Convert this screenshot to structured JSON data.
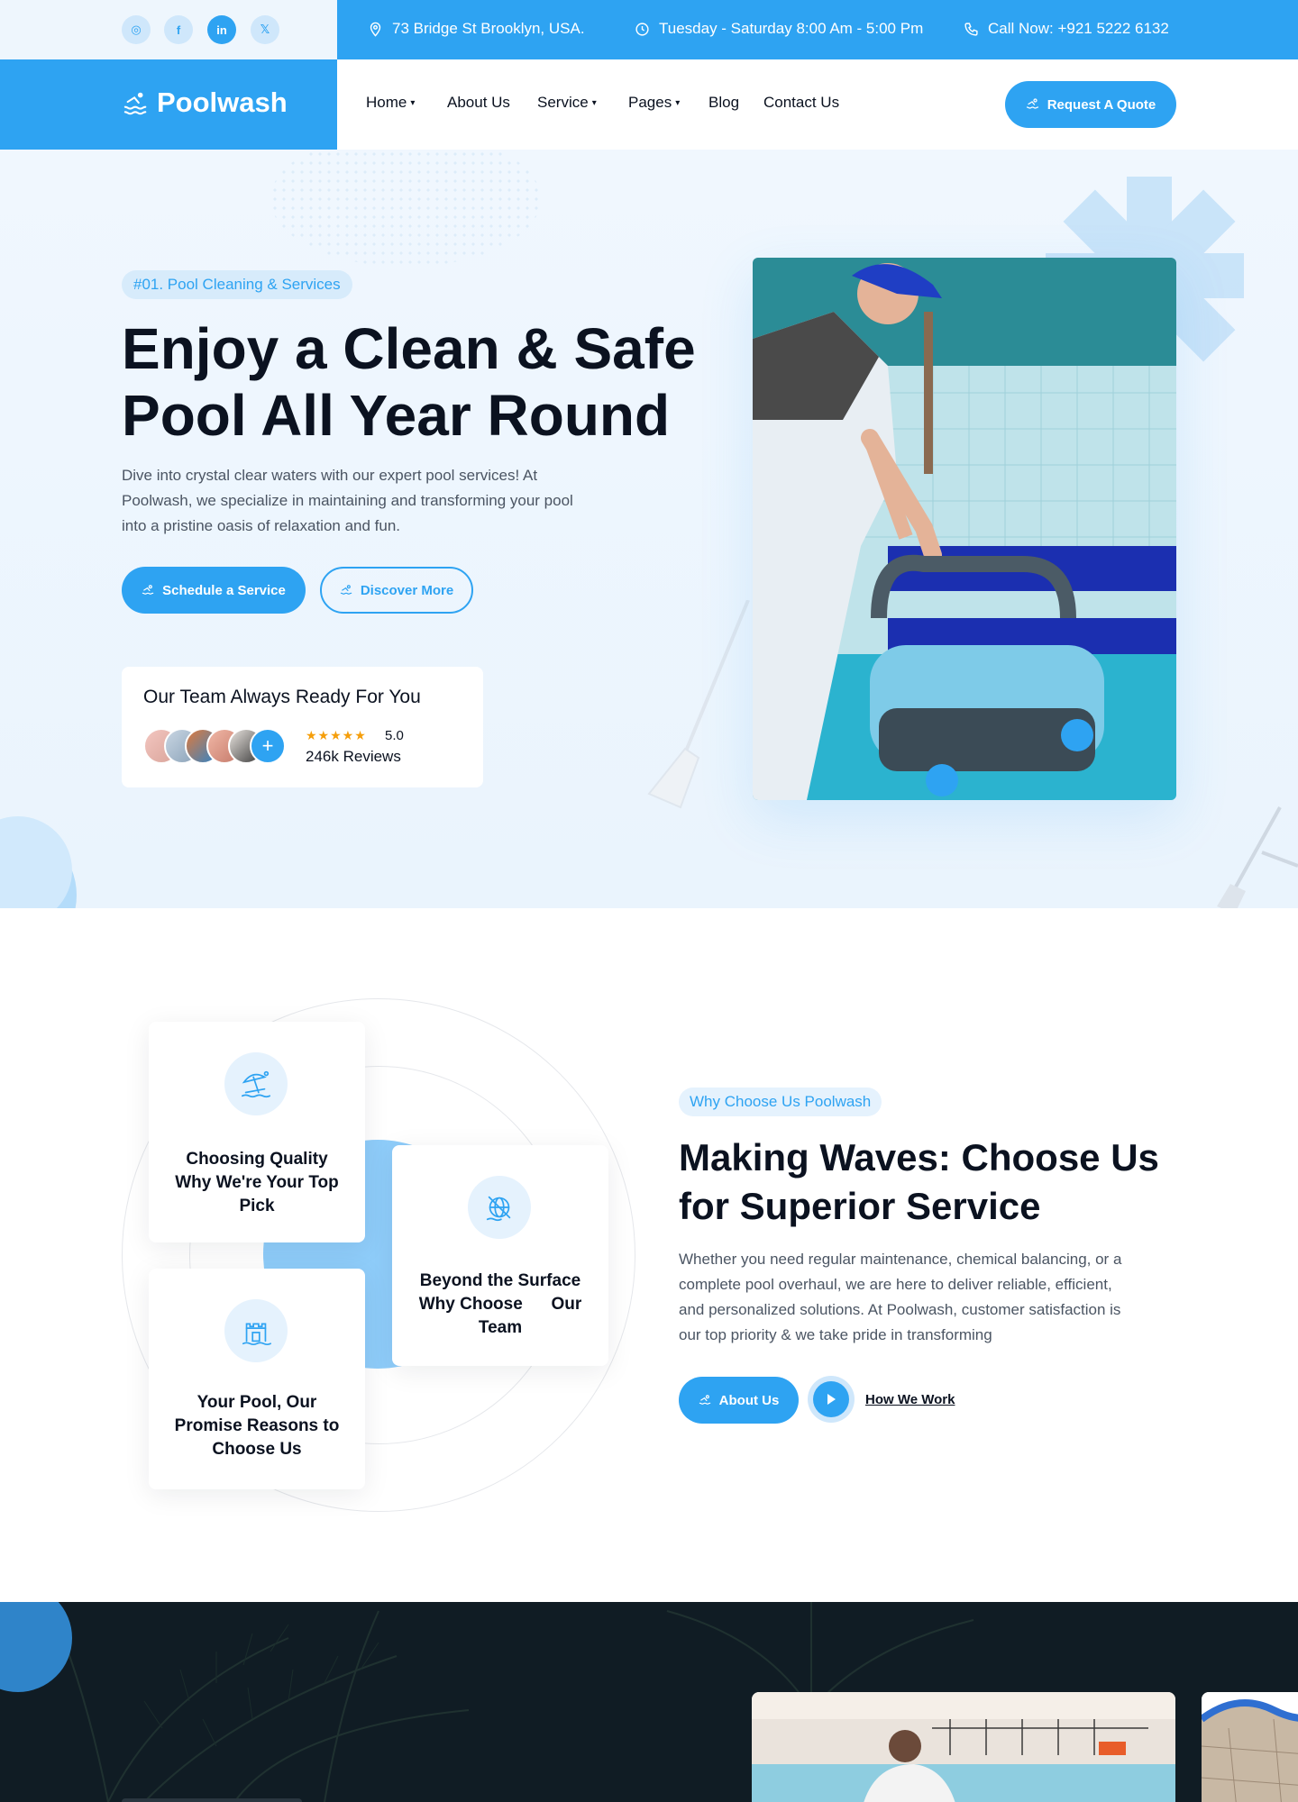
{
  "topbar": {
    "socials": [
      {
        "icon": "instagram-icon",
        "glyph": "◎"
      },
      {
        "icon": "facebook-icon",
        "glyph": "f"
      },
      {
        "icon": "linkedin-icon",
        "glyph": "in"
      },
      {
        "icon": "x-twitter-icon",
        "glyph": "𝕏"
      }
    ],
    "address": "73 Bridge St Brooklyn, USA.",
    "hours": "Tuesday - Saturday 8:00 Am - 5:00 Pm",
    "phone": "Call Now: +921 5222 6132"
  },
  "nav": {
    "logo": "Poolwash",
    "items": [
      {
        "label": "Home",
        "dropdown": true
      },
      {
        "label": "About Us",
        "dropdown": false
      },
      {
        "label": "Service",
        "dropdown": true
      },
      {
        "label": "Pages",
        "dropdown": true
      },
      {
        "label": "Blog",
        "dropdown": false
      },
      {
        "label": "Contact Us",
        "dropdown": false
      }
    ],
    "cta": "Request A Quote",
    "chevron": "⌄"
  },
  "hero": {
    "tag": "#01. Pool Cleaning & Services",
    "title_line1": "Enjoy a Clean & Safe",
    "title_line2": "Pool All Year Round",
    "description": "Dive into crystal clear waters with our expert pool services! At Poolwash, we specialize in maintaining and transforming your pool into a pristine oasis of relaxation and fun.",
    "btn_primary": "Schedule a Service",
    "btn_secondary": "Discover More",
    "team": {
      "title": "Our Team Always Ready For You",
      "plus": "+",
      "stars": "★★★★★",
      "rating": "5.0",
      "reviews": "246k Reviews"
    }
  },
  "why": {
    "cards": [
      {
        "icon": "beach-umbrella-icon",
        "title": "Choosing Quality Why We're Your Top Pick"
      },
      {
        "icon": "globe-cross-icon",
        "title": "Beyond the Surface Why Choose      Our Team"
      },
      {
        "icon": "castle-icon",
        "title": "Your Pool, Our Promise Reasons to Choose Us"
      }
    ],
    "tag": "Why Choose Us Poolwash",
    "title": "Making Waves: Choose Us for Superior Service",
    "description": " Whether you need regular maintenance, chemical balancing, or a complete pool overhaul, we are here to deliver reliable, efficient, and personalized solutions. At Poolwash, customer satisfaction is our top priority & we take pride in transforming",
    "btn": "About Us",
    "link": "How We Work"
  },
  "colors": {
    "accent": "#2ea3f2",
    "dark": "#0b1220",
    "hero_bg": "#eef6fd"
  }
}
